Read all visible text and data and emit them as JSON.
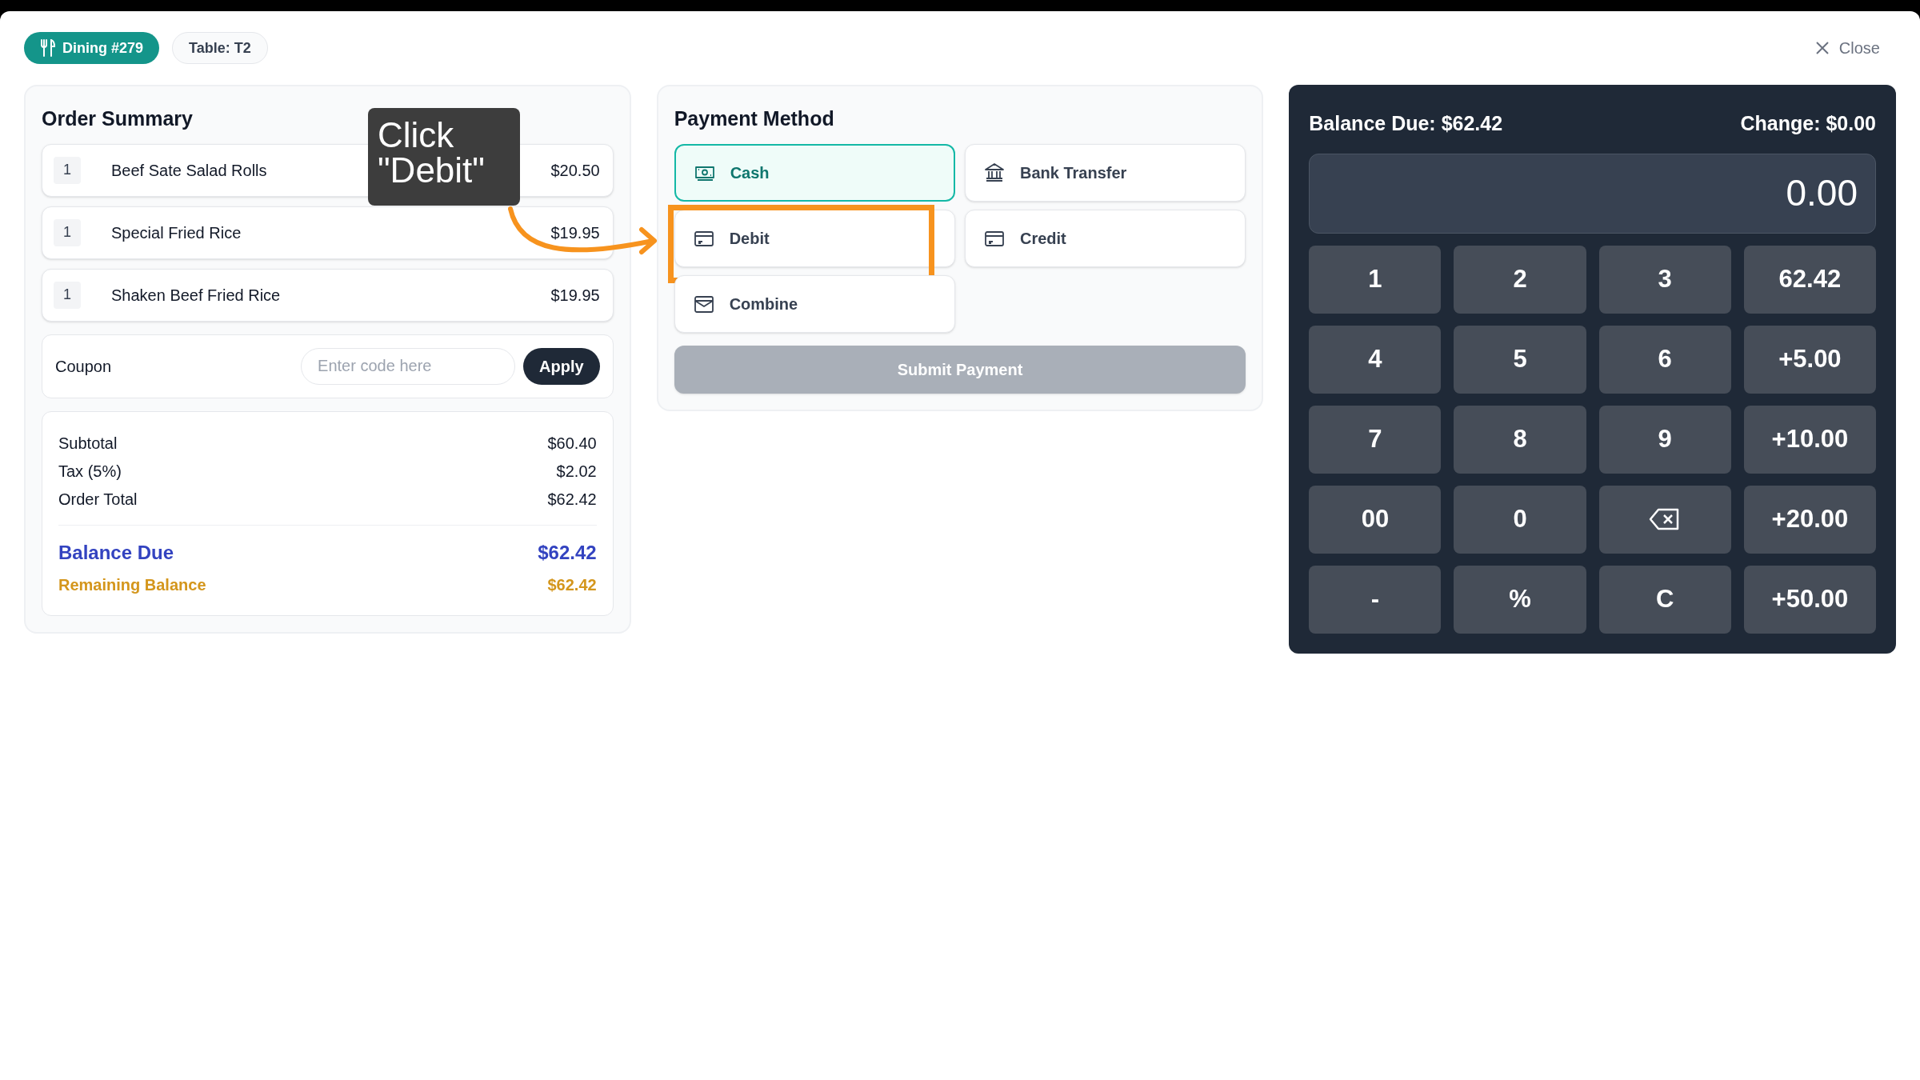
{
  "header": {
    "order_badge": "Dining #279",
    "table_badge": "Table: T2",
    "close": "Close"
  },
  "order_summary": {
    "title": "Order Summary",
    "items": [
      {
        "qty": "1",
        "name": "Beef Sate Salad Rolls",
        "price": "$20.50"
      },
      {
        "qty": "1",
        "name": "Special Fried Rice",
        "price": "$19.95"
      },
      {
        "qty": "1",
        "name": "Shaken Beef Fried Rice",
        "price": "$19.95"
      }
    ],
    "coupon": {
      "label": "Coupon",
      "placeholder": "Enter code here",
      "button": "Apply"
    },
    "totals": [
      {
        "kind": "plain",
        "label": "Subtotal",
        "value": "$60.40"
      },
      {
        "kind": "plain",
        "label": "Tax (5%)",
        "value": "$2.02"
      },
      {
        "kind": "plain",
        "label": "Order Total",
        "value": "$62.42"
      },
      {
        "kind": "balance",
        "label": "Balance Due",
        "value": "$62.42"
      },
      {
        "kind": "remaining",
        "label": "Remaining Balance",
        "value": "$62.42"
      }
    ]
  },
  "payment": {
    "title": "Payment Method",
    "methods": [
      {
        "kind": "cash",
        "label": "Cash",
        "selected": true,
        "highlighted": false
      },
      {
        "kind": "bank",
        "label": "Bank Transfer",
        "selected": false,
        "highlighted": false
      },
      {
        "kind": "card",
        "label": "Debit",
        "selected": false,
        "highlighted": true
      },
      {
        "kind": "card",
        "label": "Credit",
        "selected": false,
        "highlighted": false
      },
      {
        "kind": "wallet",
        "label": "Combine",
        "selected": false,
        "highlighted": false
      }
    ],
    "submit": {
      "label": "Submit Payment",
      "disabled": true
    }
  },
  "keypad": {
    "balance_due": "Balance Due: $62.42",
    "change": "Change: $0.00",
    "display": "0.00",
    "keys": [
      {
        "kind": "text",
        "label": "1"
      },
      {
        "kind": "text",
        "label": "2"
      },
      {
        "kind": "text",
        "label": "3"
      },
      {
        "kind": "text",
        "label": "62.42"
      },
      {
        "kind": "text",
        "label": "4"
      },
      {
        "kind": "text",
        "label": "5"
      },
      {
        "kind": "text",
        "label": "6"
      },
      {
        "kind": "text",
        "label": "+5.00"
      },
      {
        "kind": "text",
        "label": "7"
      },
      {
        "kind": "text",
        "label": "8"
      },
      {
        "kind": "text",
        "label": "9"
      },
      {
        "kind": "text",
        "label": "+10.00"
      },
      {
        "kind": "text",
        "label": "00"
      },
      {
        "kind": "text",
        "label": "0"
      },
      {
        "kind": "backspace"
      },
      {
        "kind": "text",
        "label": "+20.00"
      },
      {
        "kind": "text",
        "label": "-"
      },
      {
        "kind": "text",
        "label": "%"
      },
      {
        "kind": "text",
        "label": "C"
      },
      {
        "kind": "text",
        "label": "+50.00"
      }
    ]
  },
  "tutorial": {
    "callout": "Click \"Debit\""
  }
}
